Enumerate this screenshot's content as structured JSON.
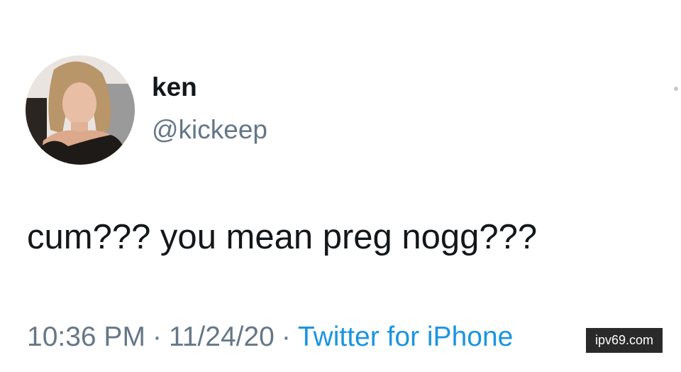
{
  "tweet": {
    "author": {
      "display_name": "ken",
      "handle": "@kickeep"
    },
    "text": "cum??? you mean preg nogg???",
    "time": "10:36 PM",
    "separator": "·",
    "date": "11/24/20",
    "source": "Twitter for iPhone"
  },
  "watermark": {
    "text": "ipv69.com"
  },
  "colors": {
    "name": "#14171a",
    "muted": "#657786",
    "link": "#1b95e0"
  }
}
